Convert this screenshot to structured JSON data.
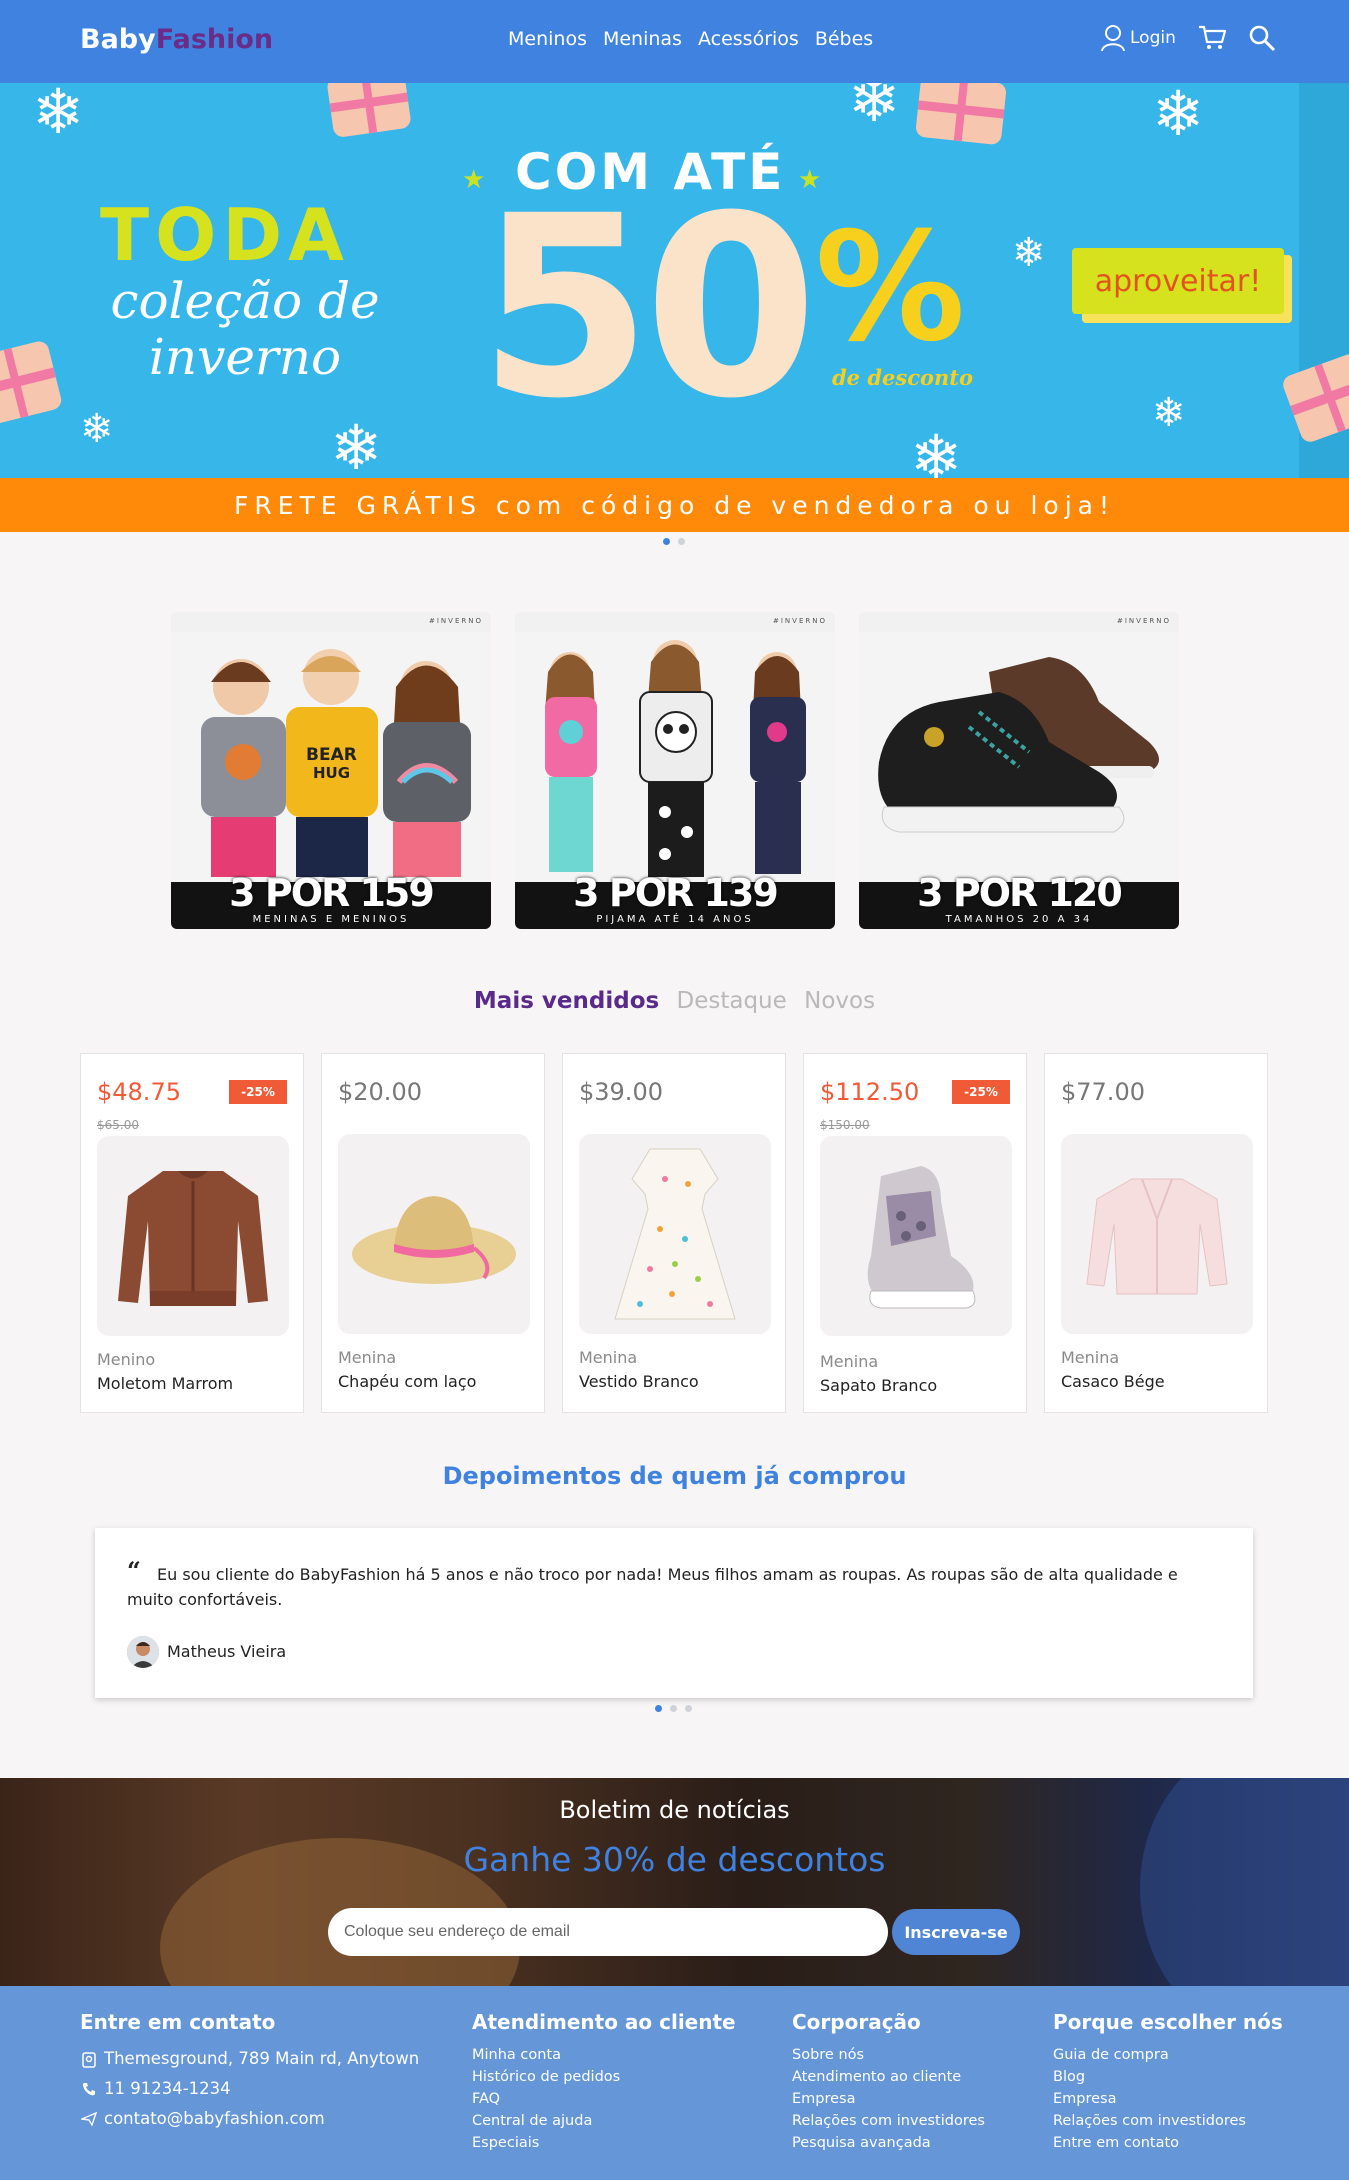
{
  "header": {
    "logo_part1": "Baby",
    "logo_part2": "Fashion",
    "nav": [
      "Meninos",
      "Meninas",
      "Acessórios",
      "Bébes"
    ],
    "login": "Login"
  },
  "hero": {
    "line1": "TODA",
    "line2": "coleção de inverno",
    "com_ate": "COM ATÉ",
    "percent_value": "50",
    "percent_sign": "%",
    "de_desconto": "de desconto",
    "cta": "aproveitar!",
    "frete": "FRETE GRÁTIS com código de vendedora ou loja!",
    "slides": 2,
    "active_slide": 1
  },
  "promos": [
    {
      "tag": "#INVERNO",
      "price": "3 POR 159",
      "sub": "MENINAS E MENINOS"
    },
    {
      "tag": "#INVERNO",
      "price": "3 POR 139",
      "sub": "PIJAMA ATÉ 14 ANOS"
    },
    {
      "tag": "#INVERNO",
      "price": "3 POR 120",
      "sub": "TAMANHOS 20 A 34"
    }
  ],
  "tabs": [
    "Mais vendidos",
    "Destaque",
    "Novos"
  ],
  "products": [
    {
      "price": "$48.75",
      "old_price": "$65.00",
      "discount": "-25%",
      "category": "Menino",
      "name": "Moletom Marrom",
      "icon": "sweater-icon"
    },
    {
      "price": "$20.00",
      "old_price": "",
      "discount": "",
      "category": "Menina",
      "name": "Chapéu com laço",
      "icon": "hat-icon"
    },
    {
      "price": "$39.00",
      "old_price": "",
      "discount": "",
      "category": "Menina",
      "name": "Vestido Branco",
      "icon": "dress-icon"
    },
    {
      "price": "$112.50",
      "old_price": "$150.00",
      "discount": "-25%",
      "category": "Menina",
      "name": "Sapato Branco",
      "icon": "sneaker-icon"
    },
    {
      "price": "$77.00",
      "old_price": "",
      "discount": "",
      "category": "Menina",
      "name": "Casaco Bége",
      "icon": "jacket-icon"
    }
  ],
  "testimonials": {
    "title": "Depoimentos de quem já comprou",
    "quote": "Eu sou cliente do BabyFashion há 5 anos e não troco por nada! Meus filhos amam as roupas. As roupas são de alta qualidade e muito confortáveis.",
    "author": "Matheus Vieira",
    "slides": 3,
    "active_slide": 1
  },
  "newsletter": {
    "title": "Boletim de notícias",
    "headline": "Ganhe 30% de descontos",
    "placeholder": "Coloque seu endereço de email",
    "button": "Inscreva-se"
  },
  "footer": {
    "contact": {
      "title": "Entre em contato",
      "address": "Themesground, 789 Main rd, Anytown",
      "phone": "11 91234-1234",
      "email": "contato@babyfashion.com"
    },
    "columns": [
      {
        "title": "Atendimento ao cliente",
        "links": [
          "Minha conta",
          "Histórico de pedidos",
          "FAQ",
          "Central de ajuda",
          "Especiais"
        ]
      },
      {
        "title": "Corporação",
        "links": [
          "Sobre nós",
          "Atendimento ao cliente",
          "Empresa",
          "Relações com investidores",
          "Pesquisa avançada"
        ]
      },
      {
        "title": "Porque escolher nós",
        "links": [
          "Guia de compra",
          "Blog",
          "Empresa",
          "Relações com investidores",
          "Entre em contato"
        ]
      }
    ]
  },
  "colors": {
    "brand_blue": "#3f82e0",
    "brand_purple": "#6a2c86",
    "sale_red": "#f05a37",
    "hero_blue": "#36b6e9",
    "banner_orange": "#ff8a0a",
    "footer_blue": "#6496d8"
  }
}
